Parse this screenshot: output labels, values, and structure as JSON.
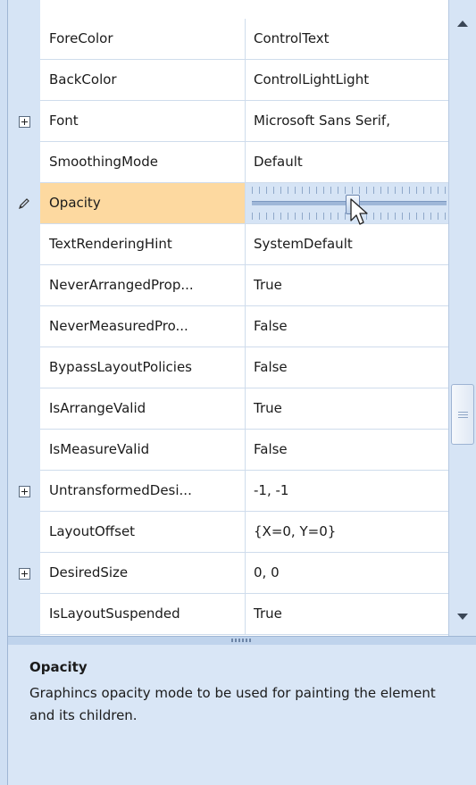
{
  "properties": [
    {
      "name": "ForeColor",
      "value": "ControlText",
      "expandable": false
    },
    {
      "name": "BackColor",
      "value": "ControlLightLight",
      "expandable": false
    },
    {
      "name": "Font",
      "value": "Microsoft Sans Serif,",
      "expandable": true
    },
    {
      "name": "SmoothingMode",
      "value": "Default",
      "expandable": false
    },
    {
      "name": "Opacity",
      "value": "",
      "expandable": false,
      "selected": true
    },
    {
      "name": "TextRenderingHint",
      "value": "SystemDefault",
      "expandable": false
    },
    {
      "name": "NeverArrangedProp...",
      "value": "True",
      "expandable": false
    },
    {
      "name": "NeverMeasuredPro...",
      "value": "False",
      "expandable": false
    },
    {
      "name": "BypassLayoutPolicies",
      "value": "False",
      "expandable": false
    },
    {
      "name": "IsArrangeValid",
      "value": "True",
      "expandable": false
    },
    {
      "name": "IsMeasureValid",
      "value": "False",
      "expandable": false
    },
    {
      "name": "UntransformedDesi...",
      "value": "-1, -1",
      "expandable": true
    },
    {
      "name": "LayoutOffset",
      "value": "{X=0, Y=0}",
      "expandable": false
    },
    {
      "name": "DesiredSize",
      "value": "0, 0",
      "expandable": true
    },
    {
      "name": "IsLayoutSuspended",
      "value": "True",
      "expandable": false
    }
  ],
  "opacity_slider": {
    "level": 0.52
  },
  "help": {
    "title": "Opacity",
    "description": "Graphincs opacity mode to be used for painting the element and its children."
  },
  "icons": {
    "expand": "plus-box-icon",
    "edit": "pencil-icon",
    "scroll_up": "triangle-up-icon",
    "scroll_down": "triangle-down-icon"
  },
  "colors": {
    "selected_name_bg": "#fdd9a0",
    "panel_bg": "#d6e4f5"
  }
}
